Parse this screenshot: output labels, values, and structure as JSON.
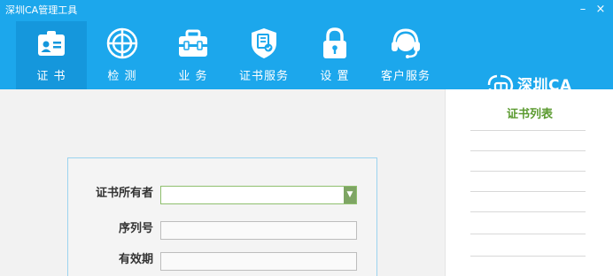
{
  "window": {
    "title": "深圳CA管理工具",
    "minimize": "–",
    "close": "×"
  },
  "toolbar": {
    "items": [
      {
        "label": "证 书",
        "icon": "certificate-icon"
      },
      {
        "label": "检 测",
        "icon": "crosshair-icon"
      },
      {
        "label": "业 务",
        "icon": "briefcase-icon"
      },
      {
        "label": "证书服务",
        "icon": "shield-document-icon"
      },
      {
        "label": "设 置",
        "icon": "lock-icon"
      },
      {
        "label": "客户服务",
        "icon": "headset-icon"
      }
    ],
    "active_index": 0
  },
  "brand": {
    "text": "深圳CA"
  },
  "form": {
    "owner_label": "证书所有者",
    "owner_value": "",
    "serial_label": "序列号",
    "serial_value": "",
    "validity_label": "有效期",
    "validity_value": ""
  },
  "sidebar": {
    "title": "证书列表",
    "items": [
      "",
      "",
      "",
      "",
      "",
      ""
    ]
  },
  "colors": {
    "primary": "#1ca7ec",
    "active": "#1597dc",
    "accent_green": "#5a9a2f"
  }
}
